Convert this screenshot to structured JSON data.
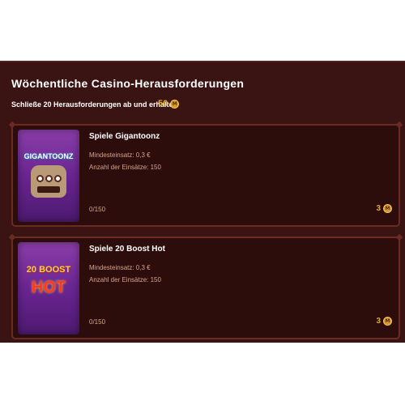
{
  "header": {
    "title": "Wöchentliche Casino-Herausforderungen",
    "subtitle": "Schließe 20 Herausforderungen ab und erhalte",
    "reward_value": "50",
    "reward_icon": "coin-icon",
    "reward_icon_glyph": "M"
  },
  "colors": {
    "panel_bg": "#3a1412",
    "card_bg": "#2c0d0c",
    "card_border": "#6b2a22",
    "accent": "#e0a63a",
    "meta_text": "#d9a38a"
  },
  "challenges": [
    {
      "title": "Spiele Gigantoonz",
      "min_bet": "Mindesteinsatz: 0,3 €",
      "bet_count": "Anzahl der Einsätze: 150",
      "progress": "0/150",
      "reward": "3",
      "thumbnail_text": "GIGANTOONZ"
    },
    {
      "title": "Spiele 20 Boost Hot",
      "min_bet": "Mindesteinsatz: 0,3 €",
      "bet_count": "Anzahl der Einsätze: 150",
      "progress": "0/150",
      "reward": "3",
      "thumbnail_text_1": "20 BOOST",
      "thumbnail_text_2": "HOT"
    }
  ]
}
